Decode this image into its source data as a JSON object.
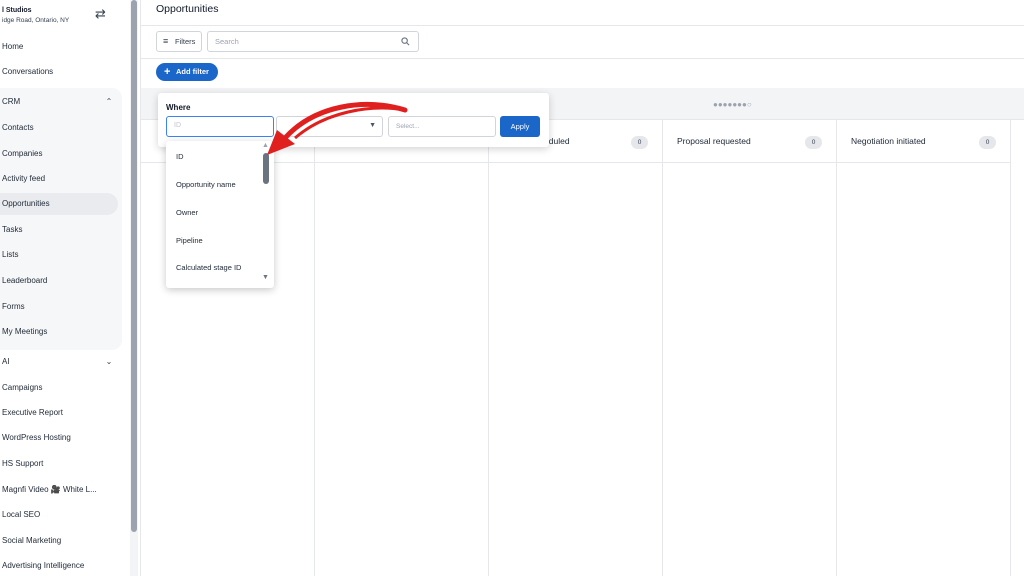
{
  "sidebar": {
    "org_name": "l Studios",
    "org_address": "idge Road, Ontario, NY",
    "items": [
      {
        "label": "Home"
      },
      {
        "label": "Conversations"
      },
      {
        "label": "CRM"
      },
      {
        "label": "Contacts"
      },
      {
        "label": "Companies"
      },
      {
        "label": "Activity feed"
      },
      {
        "label": "Opportunities"
      },
      {
        "label": "Tasks"
      },
      {
        "label": "Lists"
      },
      {
        "label": "Leaderboard"
      },
      {
        "label": "Forms"
      },
      {
        "label": "My Meetings"
      },
      {
        "label": "AI"
      },
      {
        "label": "Campaigns"
      },
      {
        "label": "Executive Report"
      },
      {
        "label": "WordPress Hosting"
      },
      {
        "label": "HS Support"
      },
      {
        "label": "Magnfi Video 🎥 White L..."
      },
      {
        "label": "Local SEO"
      },
      {
        "label": "Social Marketing"
      },
      {
        "label": "Advertising Intelligence"
      }
    ],
    "active_item": "Opportunities"
  },
  "header": {
    "title": "Opportunities"
  },
  "toolbar": {
    "filters_label": "Filters",
    "search_placeholder": "Search",
    "add_filter_label": "Add filter"
  },
  "filter_popup": {
    "where_label": "Where",
    "field_placeholder": "ID",
    "value_placeholder": "Select...",
    "apply_label": "Apply",
    "options": [
      "ID",
      "Opportunity name",
      "Owner",
      "Pipeline",
      "Calculated stage ID"
    ]
  },
  "board": {
    "columns": [
      {
        "title": "",
        "count": ""
      },
      {
        "title": "",
        "count": ""
      },
      {
        "title": "...eduled",
        "count": "0"
      },
      {
        "title": "Proposal requested",
        "count": "0"
      },
      {
        "title": "Negotiation initiated",
        "count": "0"
      }
    ]
  },
  "colors": {
    "accent": "#1a66c9",
    "annotation_arrow": "#e0201f"
  }
}
